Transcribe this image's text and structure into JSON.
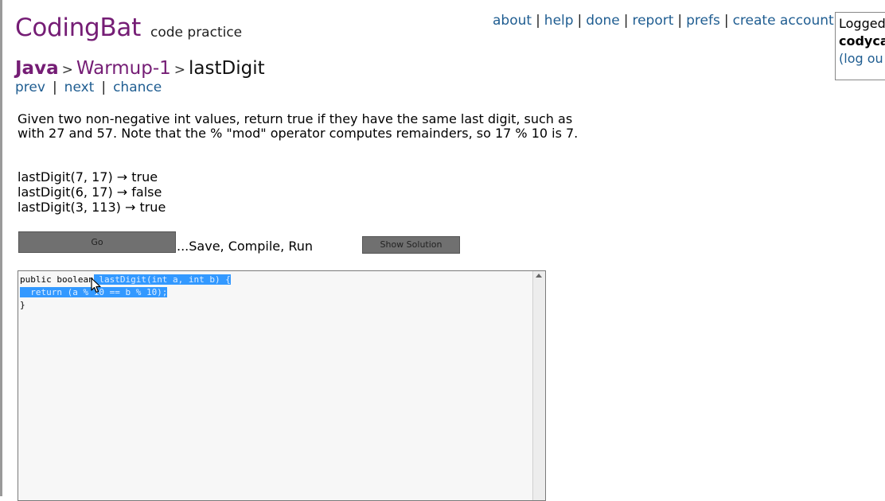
{
  "header": {
    "logo": "CodingBat",
    "tagline": "code practice",
    "nav": [
      "about",
      "help",
      "done",
      "report",
      "prefs",
      "create account"
    ]
  },
  "login_box": {
    "line1": "Logged",
    "user": "codyca",
    "logout": "(log ou"
  },
  "breadcrumb": {
    "language": "Java",
    "section": "Warmup-1",
    "problem": "lastDigit",
    "separator": ">"
  },
  "subnav": {
    "prev": "prev",
    "next": "next",
    "chance": "chance",
    "separator": "|"
  },
  "problem": {
    "description": "Given two non-negative int values, return true if they have the same last digit, such as with 27 and 57. Note that the % \"mod\" operator computes remainders, so 17 % 10 is 7.",
    "examples": [
      "lastDigit(7, 17) → true",
      "lastDigit(6, 17) → false",
      "lastDigit(3, 113) → true"
    ]
  },
  "controls": {
    "go_label": "Go",
    "run_note": "...Save, Compile, Run",
    "show_solution_label": "Show Solution"
  },
  "editor": {
    "line1_plain": "public boolean",
    "line1_selected": " lastDigit(int a, int b) {",
    "line2_selected": "  return (a % 10 == b % 10);",
    "line3": "}"
  },
  "colors": {
    "logo": "#751d75",
    "link": "#1f5d91",
    "selection": "#3399ff",
    "button": "#707070"
  }
}
